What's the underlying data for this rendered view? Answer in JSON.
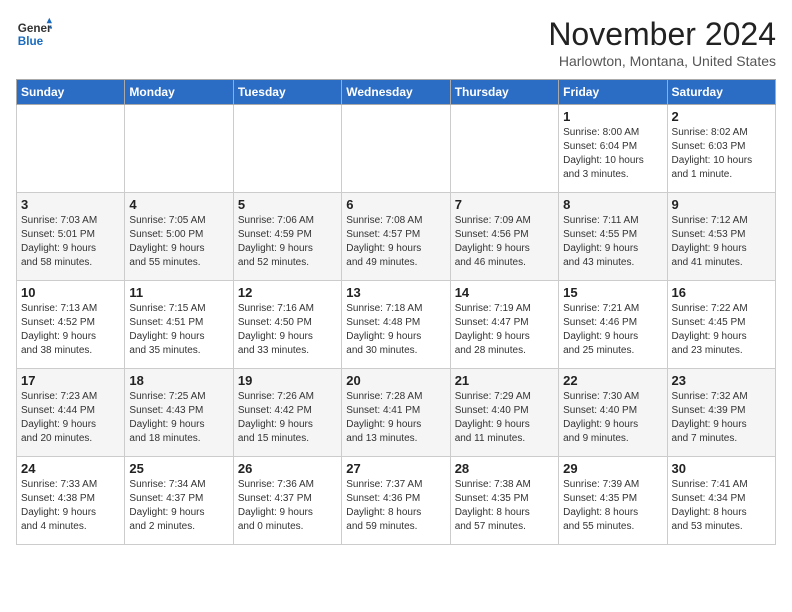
{
  "logo": {
    "line1": "General",
    "line2": "Blue"
  },
  "title": "November 2024",
  "location": "Harlowton, Montana, United States",
  "weekdays": [
    "Sunday",
    "Monday",
    "Tuesday",
    "Wednesday",
    "Thursday",
    "Friday",
    "Saturday"
  ],
  "weeks": [
    [
      {
        "day": "",
        "info": ""
      },
      {
        "day": "",
        "info": ""
      },
      {
        "day": "",
        "info": ""
      },
      {
        "day": "",
        "info": ""
      },
      {
        "day": "",
        "info": ""
      },
      {
        "day": "1",
        "info": "Sunrise: 8:00 AM\nSunset: 6:04 PM\nDaylight: 10 hours\nand 3 minutes."
      },
      {
        "day": "2",
        "info": "Sunrise: 8:02 AM\nSunset: 6:03 PM\nDaylight: 10 hours\nand 1 minute."
      }
    ],
    [
      {
        "day": "3",
        "info": "Sunrise: 7:03 AM\nSunset: 5:01 PM\nDaylight: 9 hours\nand 58 minutes."
      },
      {
        "day": "4",
        "info": "Sunrise: 7:05 AM\nSunset: 5:00 PM\nDaylight: 9 hours\nand 55 minutes."
      },
      {
        "day": "5",
        "info": "Sunrise: 7:06 AM\nSunset: 4:59 PM\nDaylight: 9 hours\nand 52 minutes."
      },
      {
        "day": "6",
        "info": "Sunrise: 7:08 AM\nSunset: 4:57 PM\nDaylight: 9 hours\nand 49 minutes."
      },
      {
        "day": "7",
        "info": "Sunrise: 7:09 AM\nSunset: 4:56 PM\nDaylight: 9 hours\nand 46 minutes."
      },
      {
        "day": "8",
        "info": "Sunrise: 7:11 AM\nSunset: 4:55 PM\nDaylight: 9 hours\nand 43 minutes."
      },
      {
        "day": "9",
        "info": "Sunrise: 7:12 AM\nSunset: 4:53 PM\nDaylight: 9 hours\nand 41 minutes."
      }
    ],
    [
      {
        "day": "10",
        "info": "Sunrise: 7:13 AM\nSunset: 4:52 PM\nDaylight: 9 hours\nand 38 minutes."
      },
      {
        "day": "11",
        "info": "Sunrise: 7:15 AM\nSunset: 4:51 PM\nDaylight: 9 hours\nand 35 minutes."
      },
      {
        "day": "12",
        "info": "Sunrise: 7:16 AM\nSunset: 4:50 PM\nDaylight: 9 hours\nand 33 minutes."
      },
      {
        "day": "13",
        "info": "Sunrise: 7:18 AM\nSunset: 4:48 PM\nDaylight: 9 hours\nand 30 minutes."
      },
      {
        "day": "14",
        "info": "Sunrise: 7:19 AM\nSunset: 4:47 PM\nDaylight: 9 hours\nand 28 minutes."
      },
      {
        "day": "15",
        "info": "Sunrise: 7:21 AM\nSunset: 4:46 PM\nDaylight: 9 hours\nand 25 minutes."
      },
      {
        "day": "16",
        "info": "Sunrise: 7:22 AM\nSunset: 4:45 PM\nDaylight: 9 hours\nand 23 minutes."
      }
    ],
    [
      {
        "day": "17",
        "info": "Sunrise: 7:23 AM\nSunset: 4:44 PM\nDaylight: 9 hours\nand 20 minutes."
      },
      {
        "day": "18",
        "info": "Sunrise: 7:25 AM\nSunset: 4:43 PM\nDaylight: 9 hours\nand 18 minutes."
      },
      {
        "day": "19",
        "info": "Sunrise: 7:26 AM\nSunset: 4:42 PM\nDaylight: 9 hours\nand 15 minutes."
      },
      {
        "day": "20",
        "info": "Sunrise: 7:28 AM\nSunset: 4:41 PM\nDaylight: 9 hours\nand 13 minutes."
      },
      {
        "day": "21",
        "info": "Sunrise: 7:29 AM\nSunset: 4:40 PM\nDaylight: 9 hours\nand 11 minutes."
      },
      {
        "day": "22",
        "info": "Sunrise: 7:30 AM\nSunset: 4:40 PM\nDaylight: 9 hours\nand 9 minutes."
      },
      {
        "day": "23",
        "info": "Sunrise: 7:32 AM\nSunset: 4:39 PM\nDaylight: 9 hours\nand 7 minutes."
      }
    ],
    [
      {
        "day": "24",
        "info": "Sunrise: 7:33 AM\nSunset: 4:38 PM\nDaylight: 9 hours\nand 4 minutes."
      },
      {
        "day": "25",
        "info": "Sunrise: 7:34 AM\nSunset: 4:37 PM\nDaylight: 9 hours\nand 2 minutes."
      },
      {
        "day": "26",
        "info": "Sunrise: 7:36 AM\nSunset: 4:37 PM\nDaylight: 9 hours\nand 0 minutes."
      },
      {
        "day": "27",
        "info": "Sunrise: 7:37 AM\nSunset: 4:36 PM\nDaylight: 8 hours\nand 59 minutes."
      },
      {
        "day": "28",
        "info": "Sunrise: 7:38 AM\nSunset: 4:35 PM\nDaylight: 8 hours\nand 57 minutes."
      },
      {
        "day": "29",
        "info": "Sunrise: 7:39 AM\nSunset: 4:35 PM\nDaylight: 8 hours\nand 55 minutes."
      },
      {
        "day": "30",
        "info": "Sunrise: 7:41 AM\nSunset: 4:34 PM\nDaylight: 8 hours\nand 53 minutes."
      }
    ]
  ]
}
